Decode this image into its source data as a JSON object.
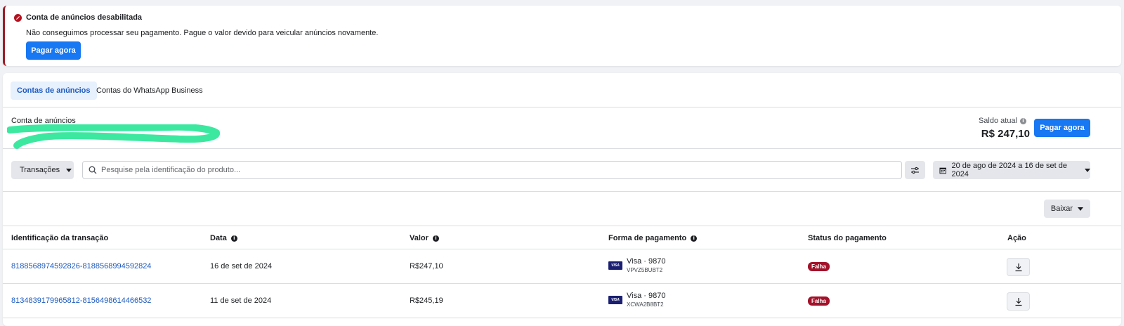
{
  "alert": {
    "title": "Conta de anúncios desabilitada",
    "message": "Não conseguimos processar seu pagamento. Pague o valor devido para veicular anúncios novamente.",
    "button": "Pagar agora"
  },
  "tabs": [
    {
      "label": "Contas de anúncios",
      "active": true
    },
    {
      "label": "Contas do WhatsApp Business",
      "active": false
    }
  ],
  "account": {
    "label": "Conta de anúncios",
    "saldo_label": "Saldo atual",
    "saldo_value": "R$ 247,10",
    "button": "Pagar agora"
  },
  "filters": {
    "type_dropdown": "Transações",
    "search_placeholder": "Pesquise pela identificação do produto...",
    "date_range": "20 de ago de 2024 a 16 de set de 2024"
  },
  "download": {
    "label": "Baixar"
  },
  "table": {
    "headers": {
      "id": "Identificação da transação",
      "date": "Data",
      "value": "Valor",
      "payment": "Forma de pagamento",
      "status": "Status do pagamento",
      "action": "Ação"
    },
    "rows": [
      {
        "id": "8188568974592826-8188568994592824",
        "date": "16 de set de 2024",
        "value": "R$247,10",
        "card": "Visa · 9870",
        "ref": "VPVZ5BUBT2",
        "status": "Falha"
      },
      {
        "id": "8134839179965812-8156498614466532",
        "date": "11 de set de 2024",
        "value": "R$245,19",
        "card": "Visa · 9870",
        "ref": "XCWA2B8BT2",
        "status": "Falha"
      }
    ]
  },
  "colors": {
    "primary": "#1877f2",
    "error": "#a3122a",
    "link": "#1d5bbf"
  },
  "icons": {
    "visa": "VISA"
  }
}
